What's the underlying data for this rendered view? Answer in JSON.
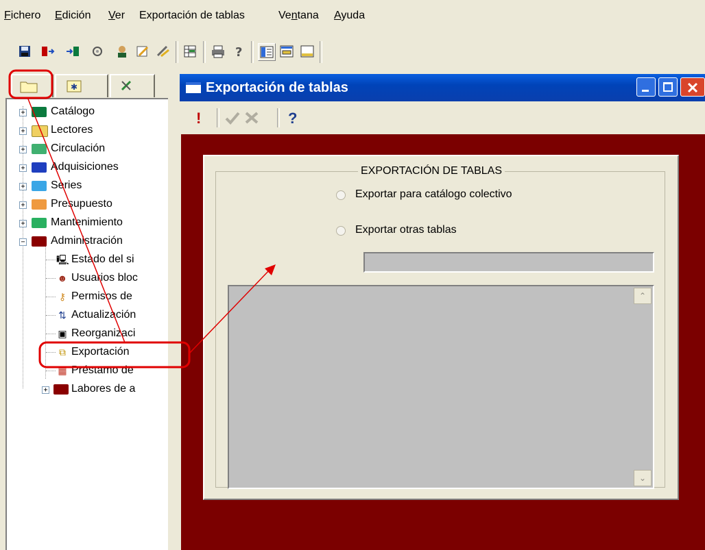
{
  "menu": [
    {
      "label": "Fichero",
      "u": "F"
    },
    {
      "label": "Edición",
      "u": "E"
    },
    {
      "label": "Ver",
      "u": "V"
    },
    {
      "label": "Exportación de tablas",
      "u": ""
    },
    {
      "label": "Ventana",
      "u": "n"
    },
    {
      "label": "Ayuda",
      "u": "A"
    }
  ],
  "toolbar_icons": [
    "save-icon",
    "exit-icon",
    "enter-icon",
    "refresh-icon",
    "user-icon",
    "edit-icon",
    "tools-icon",
    "table-icon",
    "print-icon",
    "help-icon",
    "tree-view-icon",
    "window-icon",
    "window-bottom-icon"
  ],
  "tree": {
    "items": [
      {
        "label": "Catálogo",
        "color": "#0b7a3e"
      },
      {
        "label": "Lectores",
        "color": "#f0d060"
      },
      {
        "label": "Circulación",
        "color": "#40b070"
      },
      {
        "label": "Adquisiciones",
        "color": "#1f3fbf"
      },
      {
        "label": "Series",
        "color": "#3aa6e6"
      },
      {
        "label": "Presupuesto",
        "color": "#ef9a40"
      },
      {
        "label": "Mantenimiento",
        "color": "#29b060"
      },
      {
        "label": "Administración",
        "color": "#8a0000"
      }
    ],
    "children": [
      {
        "label": "Estado del si",
        "icon": "computer-icon"
      },
      {
        "label": "Usuarios bloc",
        "icon": "users-icon"
      },
      {
        "label": "Permisos de",
        "icon": "permissions-icon"
      },
      {
        "label": "Actualización",
        "icon": "update-icon"
      },
      {
        "label": "Reorganizaci",
        "icon": "reorganize-icon"
      },
      {
        "label": "Exportación",
        "icon": "export-icon"
      },
      {
        "label": "Préstamo de",
        "icon": "loan-icon"
      }
    ],
    "last": {
      "label": "Labores de a",
      "color": "#8a0000"
    }
  },
  "window": {
    "title": "Exportación de tablas",
    "toolbar": {
      "exclaim": "!",
      "help": "?"
    },
    "group_title": "EXPORTACIÓN DE TABLAS",
    "radio1": "Exportar para catálogo colectivo",
    "radio2": "Exportar otras tablas"
  },
  "colors": {
    "annotation": "#e00000",
    "titlebar": "#0043b8",
    "dialog_bg": "#7b0000"
  }
}
